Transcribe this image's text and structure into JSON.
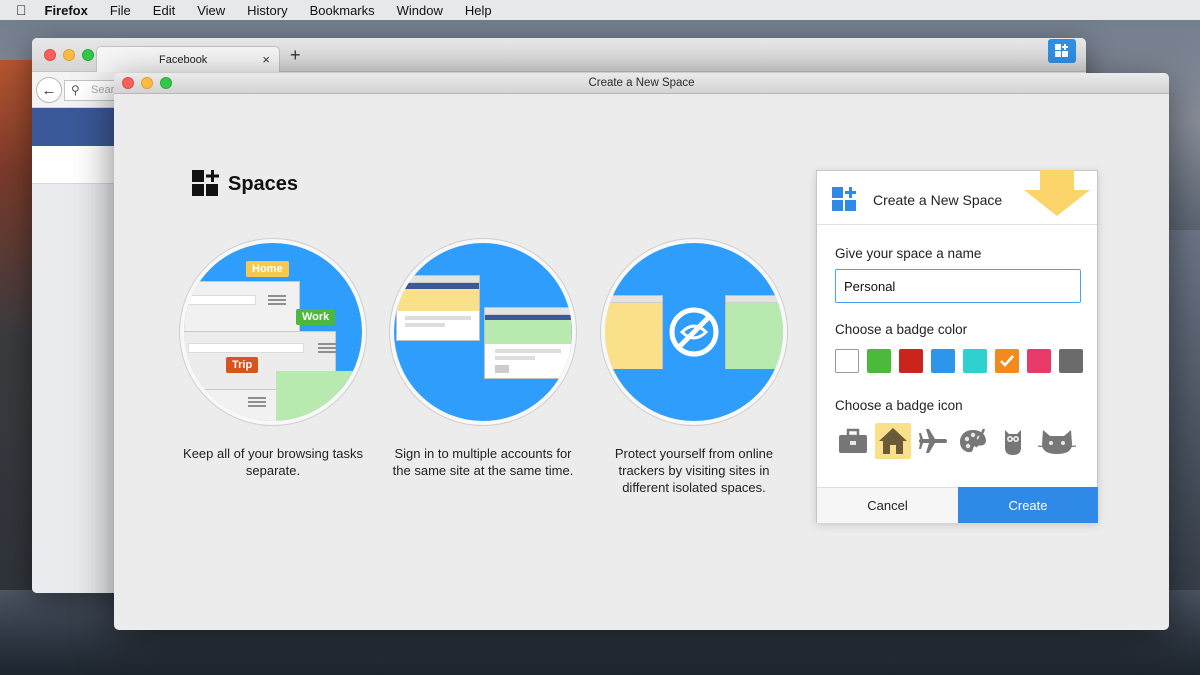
{
  "menubar": {
    "app": "Firefox",
    "items": [
      "File",
      "Edit",
      "View",
      "History",
      "Bookmarks",
      "Window",
      "Help"
    ]
  },
  "browser": {
    "tab_title": "Facebook",
    "tab_close": "×",
    "new_tab": "+",
    "url_placeholder": "Sear",
    "facebook_color": "#3b5998"
  },
  "dialog": {
    "title": "Create a New Space",
    "brand": "Spaces",
    "features": [
      {
        "caption": "Keep all of your browsing tasks separate.",
        "tags": [
          "Home",
          "Work",
          "Trip"
        ]
      },
      {
        "caption": "Sign in to multiple accounts for the same site at the same time."
      },
      {
        "caption": "Protect yourself from online trackers by visiting sites in different  isolated spaces."
      }
    ]
  },
  "panel": {
    "title": "Create a New Space",
    "name_label": "Give your space a name",
    "name_value": "Personal",
    "color_label": "Choose a badge color",
    "colors": [
      "#ffffff",
      "#4cb83c",
      "#c9251d",
      "#2e96ea",
      "#2fd1cf",
      "#f28a20",
      "#e8396b",
      "#6b6b6b"
    ],
    "selected_color_index": 5,
    "icon_label": "Choose a badge icon",
    "icons": [
      "briefcase-icon",
      "house-icon",
      "airplane-icon",
      "palette-icon",
      "owl-icon",
      "cat-icon"
    ],
    "selected_icon_index": 1,
    "cancel_label": "Cancel",
    "create_label": "Create",
    "accent": "#2e8ae6"
  }
}
